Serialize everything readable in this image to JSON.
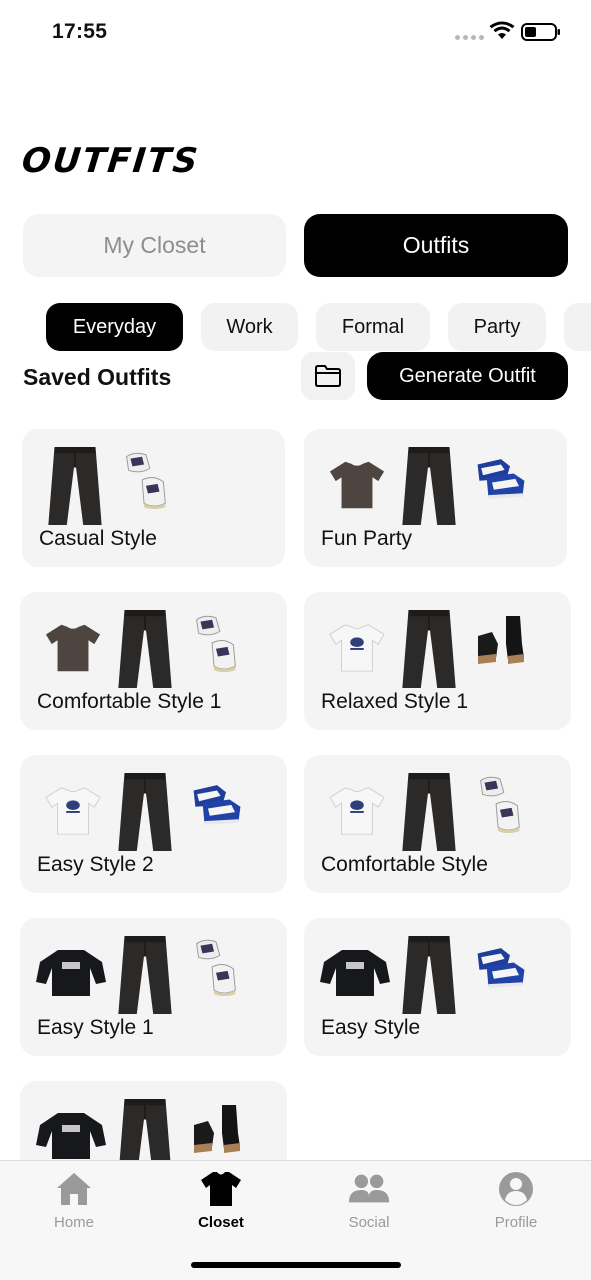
{
  "status_bar": {
    "time": "17:55"
  },
  "header": {
    "title": "OUTFITS"
  },
  "segmented": {
    "closet_label": "My Closet",
    "outfits_label": "Outfits",
    "selected": "Outfits"
  },
  "categories": {
    "items": [
      "Everyday",
      "Work",
      "Formal",
      "Party"
    ],
    "selected": "Everyday"
  },
  "saved": {
    "title": "Saved Outfits",
    "folder_icon": "folder-icon",
    "generate_label": "Generate Outfit"
  },
  "outfits": [
    {
      "name": "Casual Style",
      "items": [
        "jeans",
        "sneakers-white"
      ]
    },
    {
      "name": "Fun Party",
      "items": [
        "tshirt-brown",
        "jeans",
        "sneakers-blue"
      ]
    },
    {
      "name": "Comfortable Style 1",
      "items": [
        "tshirt-brown",
        "jeans",
        "sneakers-white"
      ]
    },
    {
      "name": "Relaxed Style 1",
      "items": [
        "tshirt-white",
        "jeans",
        "boots"
      ]
    },
    {
      "name": "Easy Style 2",
      "items": [
        "tshirt-white",
        "jeans",
        "sneakers-blue"
      ]
    },
    {
      "name": "Comfortable Style",
      "items": [
        "tshirt-white",
        "jeans",
        "sneakers-white"
      ]
    },
    {
      "name": "Easy Style 1",
      "items": [
        "sweater-black",
        "jeans",
        "sneakers-white"
      ]
    },
    {
      "name": "Easy Style",
      "items": [
        "sweater-black",
        "jeans",
        "sneakers-blue"
      ]
    },
    {
      "name": "",
      "items": [
        "sweater-black",
        "jeans",
        "boots"
      ]
    }
  ],
  "tabs": [
    {
      "label": "Home",
      "icon": "home-icon"
    },
    {
      "label": "Closet",
      "icon": "tshirt-icon",
      "active": true
    },
    {
      "label": "Social",
      "icon": "people-icon"
    },
    {
      "label": "Profile",
      "icon": "profile-icon"
    }
  ]
}
